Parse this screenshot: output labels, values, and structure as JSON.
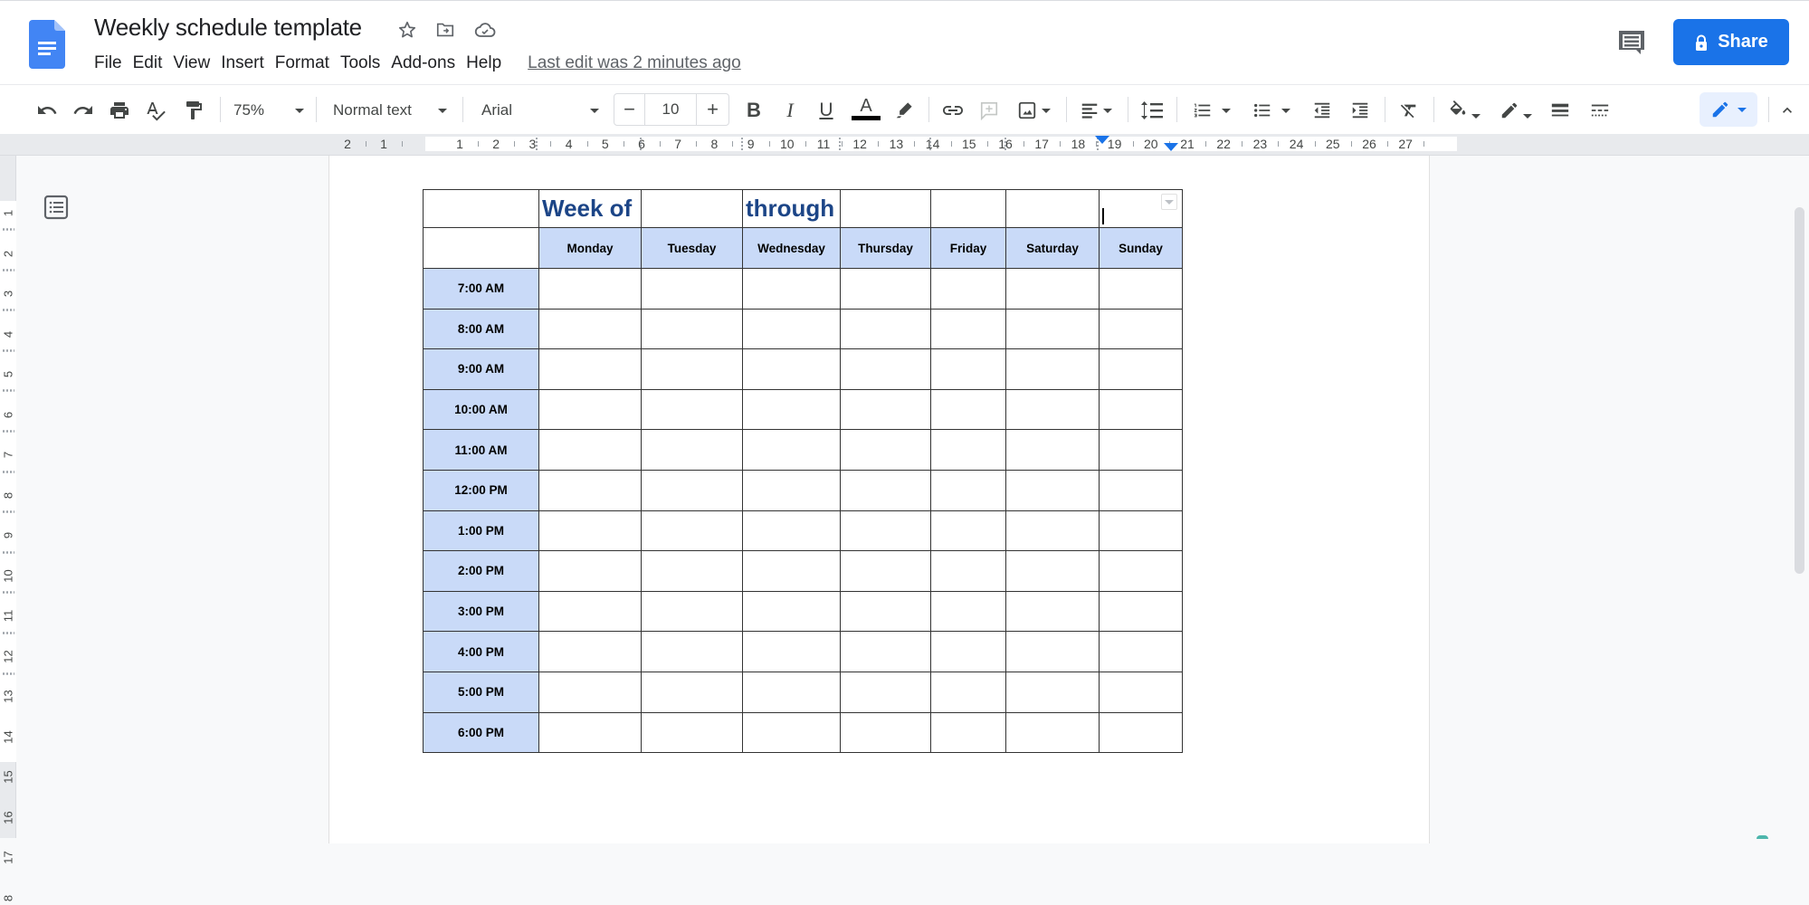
{
  "app": {
    "name": "Google Docs",
    "doc_title": "Weekly schedule template",
    "title_icons": [
      "star-icon",
      "move-to-folder-icon",
      "cloud-saved-icon"
    ],
    "menu": [
      "File",
      "Edit",
      "View",
      "Insert",
      "Format",
      "Tools",
      "Add-ons",
      "Help"
    ],
    "last_edit": "Last edit was 2 minutes ago",
    "share_label": "Share",
    "accent_color": "#1a73e8"
  },
  "toolbar": {
    "zoom": "75%",
    "style": "Normal text",
    "font": "Arial",
    "font_size": "10",
    "minus": "−",
    "plus": "+",
    "bold": "B",
    "italic": "I",
    "underline": "U",
    "text_color_glyph": "A",
    "text_color": "#000000"
  },
  "ruler": {
    "horizontal": [
      "2",
      "1",
      "1",
      "2",
      "3",
      "4",
      "5",
      "6",
      "7",
      "8",
      "9",
      "10",
      "11",
      "12",
      "13",
      "14",
      "15",
      "16",
      "17",
      "18",
      "19",
      "20",
      "21",
      "22",
      "23",
      "24",
      "25",
      "26",
      "27"
    ],
    "vertical": [
      "1",
      "2",
      "3",
      "4",
      "5",
      "6",
      "7",
      "8",
      "9",
      "10",
      "11",
      "12",
      "13",
      "14",
      "15",
      "16",
      "17",
      "8"
    ]
  },
  "table": {
    "title_row": {
      "week_of": "Week of",
      "through": "through"
    },
    "days": [
      "Monday",
      "Tuesday",
      "Wednesday",
      "Thursday",
      "Friday",
      "Saturday",
      "Sunday"
    ],
    "times": [
      "7:00 AM",
      "8:00 AM",
      "9:00 AM",
      "10:00 AM",
      "11:00 AM",
      "12:00 PM",
      "1:00 PM",
      "2:00 PM",
      "3:00 PM",
      "4:00 PM",
      "5:00 PM",
      "6:00 PM"
    ],
    "header_fill": "#c9daf8",
    "title_color": "#1c4587"
  }
}
